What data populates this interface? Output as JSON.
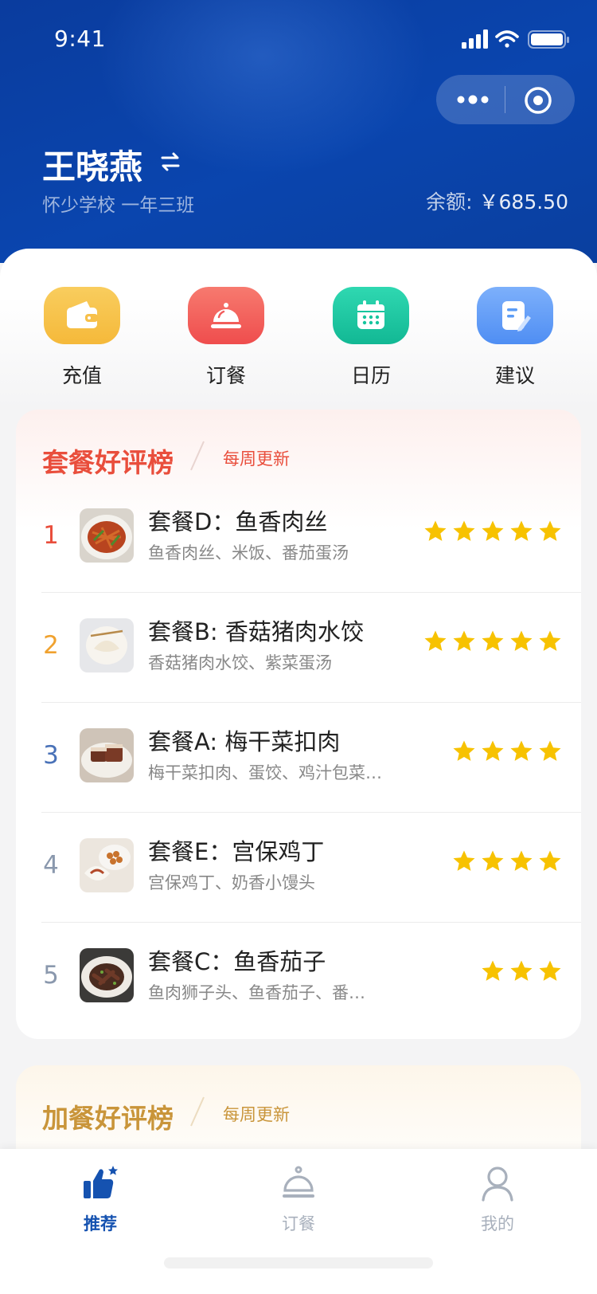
{
  "status": {
    "time": "9:41"
  },
  "user": {
    "name": "王晓燕",
    "school": "怀少学校 一年三班"
  },
  "balance": {
    "label": "余额:",
    "value": "￥685.50"
  },
  "quick_actions": [
    {
      "label": "充值",
      "icon": "wallet-icon",
      "color": "#f7c04a"
    },
    {
      "label": "订餐",
      "icon": "cloche-icon",
      "color": "#f25e5e"
    },
    {
      "label": "日历",
      "icon": "calendar-icon",
      "color": "#16c59e"
    },
    {
      "label": "建议",
      "icon": "note-icon",
      "color": "#5b9cf6"
    }
  ],
  "ranking_card": {
    "title": "套餐好评榜",
    "subtitle": "每周更新",
    "items": [
      {
        "rank": "1",
        "name": "套餐D：鱼香肉丝",
        "desc": "鱼香肉丝、米饭、番茄蛋汤",
        "stars": 5,
        "rank_color": "#e94e3c"
      },
      {
        "rank": "2",
        "name": "套餐B: 香菇猪肉水饺",
        "desc": "香菇猪肉水饺、紫菜蛋汤",
        "stars": 5,
        "rank_color": "#f0a22f"
      },
      {
        "rank": "3",
        "name": "套餐A: 梅干菜扣肉",
        "desc": "梅干菜扣肉、蛋饺、鸡汁包菜…",
        "stars": 4,
        "rank_color": "#4a72b8"
      },
      {
        "rank": "4",
        "name": "套餐E：宫保鸡丁",
        "desc": "宫保鸡丁、奶香小馒头",
        "stars": 4,
        "rank_color": "#8a98ad"
      },
      {
        "rank": "5",
        "name": "套餐C：鱼香茄子",
        "desc": "鱼肉狮子头、鱼香茄子、番…",
        "stars": 3,
        "rank_color": "#8a98ad"
      }
    ]
  },
  "extra_card": {
    "title": "加餐好评榜",
    "subtitle": "每周更新"
  },
  "tabbar": {
    "tabs": [
      {
        "label": "推荐",
        "icon": "thumbs-up-icon",
        "active": true
      },
      {
        "label": "订餐",
        "icon": "cloche-icon",
        "active": false
      },
      {
        "label": "我的",
        "icon": "user-icon",
        "active": false
      }
    ],
    "active_color": "#1552b0",
    "inactive_color": "#a8b0bc"
  }
}
